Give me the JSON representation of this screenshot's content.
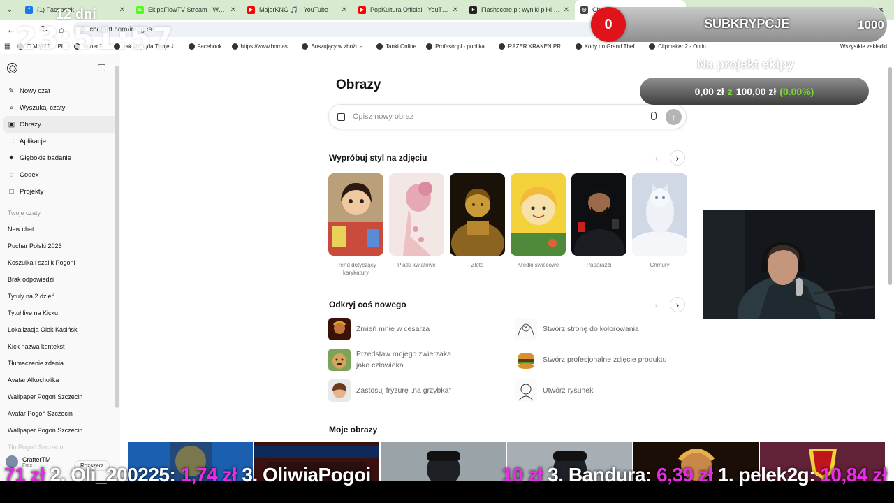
{
  "tabs": [
    {
      "title": "(1) Facebook",
      "color": "#1877f2",
      "glyph": "f"
    },
    {
      "title": "EkipaFlowTV Stream - Watch Live",
      "color": "#53fc18",
      "glyph": "K"
    },
    {
      "title": "MajorKNG 🎵 - YouTube",
      "color": "#ff0000",
      "glyph": "▶"
    },
    {
      "title": "PopKultura Official - YouTube",
      "color": "#ff0000",
      "glyph": "▶"
    },
    {
      "title": "Flashscore.pl: wyniki piłki nożnej",
      "color": "#222222",
      "glyph": "F"
    },
    {
      "title": "ChatGPT",
      "color": "#444444",
      "glyph": "◎"
    }
  ],
  "address": {
    "prefix": "chatgpt",
    "url": ".com/images"
  },
  "bookmarks": [
    "O Mojej K... PL",
    "slither.io",
    "Jak wygląda Twoje ż...",
    "Facebook",
    "https://www.bomas...",
    "Buszujący w zbożu -...",
    "Tanki Online",
    "Profesor.pl - publika...",
    "RAZER KRAKEN PR...",
    "Kody do Grand Thef...",
    "Clipmaker 2 - Onlin..."
  ],
  "bookmarks_all": "Wszystkie zakładki",
  "sidebar": {
    "nav": [
      {
        "label": "Nowy czat",
        "icon": "new-chat-icon",
        "glyph": "✎"
      },
      {
        "label": "Wyszukaj czaty",
        "icon": "search-icon",
        "glyph": "⌕"
      },
      {
        "label": "Obrazy",
        "icon": "images-icon",
        "glyph": "▣",
        "active": true
      },
      {
        "label": "Aplikacje",
        "icon": "apps-icon",
        "glyph": "∷"
      },
      {
        "label": "Głębokie badanie",
        "icon": "deep-research-icon",
        "glyph": "✦"
      },
      {
        "label": "Codex",
        "icon": "codex-icon",
        "glyph": "◌"
      },
      {
        "label": "Projekty",
        "icon": "folder-icon",
        "glyph": "□"
      }
    ],
    "section_label": "Twoje czaty",
    "chats": [
      "New chat",
      "Puchar Polski 2026",
      "Koszulka i szalik Pogoni",
      "Brak odpowiedzi",
      "Tytuły na 2 dzień",
      "Tytuł live na Kicku",
      "Lokalizacja Olek Kasiński",
      "Kick nazwa kontekst",
      "Tłumaczenie zdania",
      "Avatar Alkocholika",
      "Wallpaper Pogoń Szczecin",
      "Avatar Pogoń Szczecin",
      "Wallpaper Pogoń Szczecin",
      "Tło Pogoń Szczecin"
    ],
    "user": {
      "name": "CrafterTM",
      "plan": "Free",
      "upgrade": "Rozszerz"
    }
  },
  "main": {
    "title": "Obrazy",
    "prompt_placeholder": "Opisz nowy obraz",
    "styles_title": "Wypróbuj styl na zdjęciu",
    "styles": [
      {
        "label": "Trend dotyczący karykatury"
      },
      {
        "label": "Płatki kwiatowe"
      },
      {
        "label": "Złoto"
      },
      {
        "label": "Kredki świecowe"
      },
      {
        "label": "Paparazzi"
      },
      {
        "label": "Chmury"
      }
    ],
    "discover_title": "Odkryj coś nowego",
    "discover": [
      {
        "label": "Zmień mnie w cesarza"
      },
      {
        "label": "Stwórz stronę do kolorowania"
      },
      {
        "label": "Przedstaw mojego zwierzaka jako człowieka"
      },
      {
        "label": "Stwórz profesjonalne zdjęcie produktu"
      },
      {
        "label": "Zastosuj fryzurę „na grzybka”"
      },
      {
        "label": "Utwórz rysunek"
      }
    ],
    "my_images_title": "Moje obrazy"
  },
  "overlay": {
    "days": "12 dni",
    "time": "23:51:57",
    "sub_count": "0",
    "sub_label": "SUBKRYPCJE",
    "sub_goal": "1000",
    "project_label": "Na projekt ekipy",
    "project_amount": "0,00 zł",
    "project_z": "z",
    "project_goal": "100,00 zł",
    "project_pct": "(0.00%)",
    "ticker_left": [
      {
        "t": "71 zł",
        "c": "m"
      },
      {
        "t": " 2. Oli_200225: ",
        "c": "w"
      },
      {
        "t": "1,74 zł",
        "c": "m"
      },
      {
        "t": " 3. OliwiaPogoi",
        "c": "w"
      }
    ],
    "ticker_right": [
      {
        "t": "10 zł",
        "c": "m"
      },
      {
        "t": " 3. Bandura: ",
        "c": "w"
      },
      {
        "t": "6,39 zł",
        "c": "m"
      },
      {
        "t": " 1. pelek2g: ",
        "c": "w"
      },
      {
        "t": "10,84 zł",
        "c": "m"
      }
    ]
  }
}
